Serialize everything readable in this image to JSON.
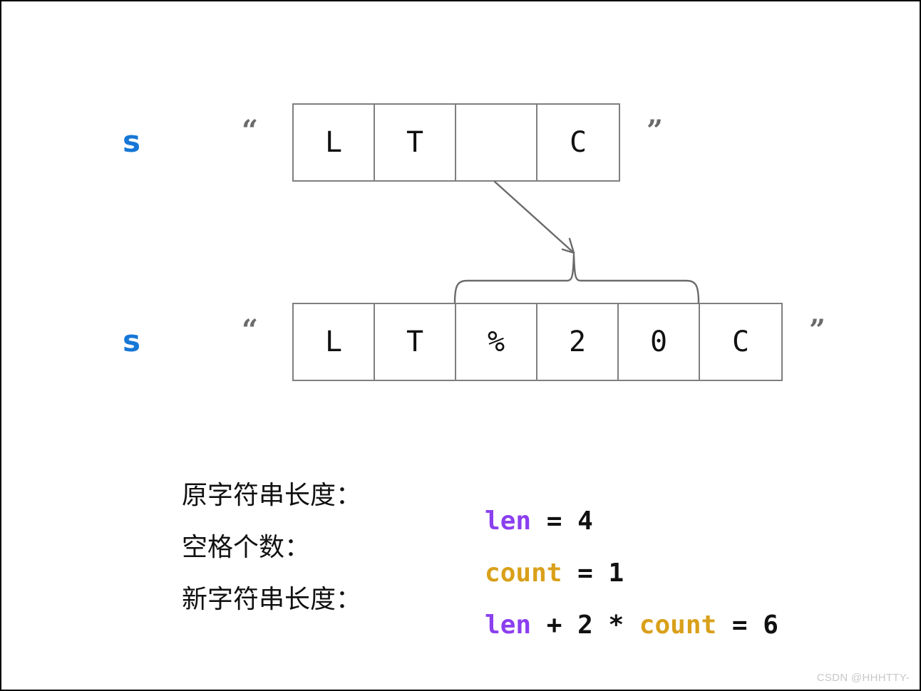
{
  "diagram": {
    "title": "URL space encoding string expansion diagram",
    "colors": {
      "variable_blue": "#1677d6",
      "len_purple": "#8b3ff0",
      "count_gold": "#d9a01a",
      "box_border_gray": "#7f7f7f",
      "quote_gray": "#6b6b6b",
      "connector_gray": "#6b6b6b",
      "watermark_gray": "#c8c8c8"
    },
    "rows": [
      {
        "name": "original-string",
        "variable": "s",
        "quote_open": "“",
        "quote_close": "”",
        "cells": [
          "L",
          "T",
          " ",
          "C"
        ]
      },
      {
        "name": "encoded-string",
        "variable": "s",
        "quote_open": "“",
        "quote_close": "”",
        "cells": [
          "L",
          "T",
          "%",
          "2",
          "0",
          "C"
        ]
      }
    ],
    "annotation": {
      "arrow_label": "space-expands-to-percent-20",
      "brace_label": "three-replacement-characters"
    }
  },
  "equations": [
    {
      "label": "原字符串长度：",
      "tokens": [
        {
          "text": "len",
          "style": "len"
        },
        {
          "text": " = ",
          "style": "op"
        },
        {
          "text": "4",
          "style": "op"
        }
      ]
    },
    {
      "label": "空格个数：",
      "tokens": [
        {
          "text": "count",
          "style": "count"
        },
        {
          "text": " = ",
          "style": "op"
        },
        {
          "text": "1",
          "style": "op"
        }
      ]
    },
    {
      "label": "新字符串长度：",
      "tokens": [
        {
          "text": "len",
          "style": "len"
        },
        {
          "text": " + 2 * ",
          "style": "op"
        },
        {
          "text": "count",
          "style": "count"
        },
        {
          "text": " = ",
          "style": "op"
        },
        {
          "text": "6",
          "style": "op"
        }
      ]
    }
  ],
  "watermark": {
    "text": "CSDN @HHHTTY-"
  }
}
